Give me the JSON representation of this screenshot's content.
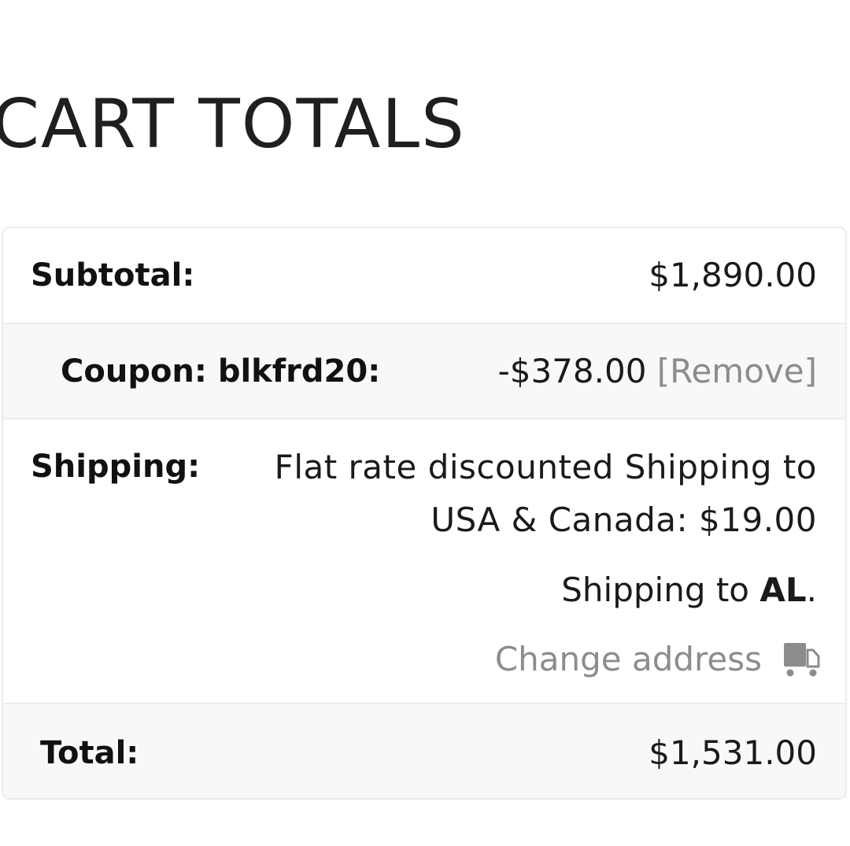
{
  "heading": "CART TOTALS",
  "subtotal": {
    "label": "Subtotal:",
    "value": "$1,890.00"
  },
  "coupon": {
    "label": "Coupon: blkfrd20:",
    "value": "-$378.00",
    "remove_label": "[Remove]"
  },
  "shipping": {
    "label": "Shipping:",
    "method": "Flat rate discounted Shipping to USA & Canada: $19.00",
    "destination_prefix": "Shipping to ",
    "destination": "AL",
    "destination_suffix": ".",
    "change_address_label": "Change address",
    "change_address_icon": "truck-icon"
  },
  "total": {
    "label": "Total:",
    "value": "$1,531.00"
  }
}
